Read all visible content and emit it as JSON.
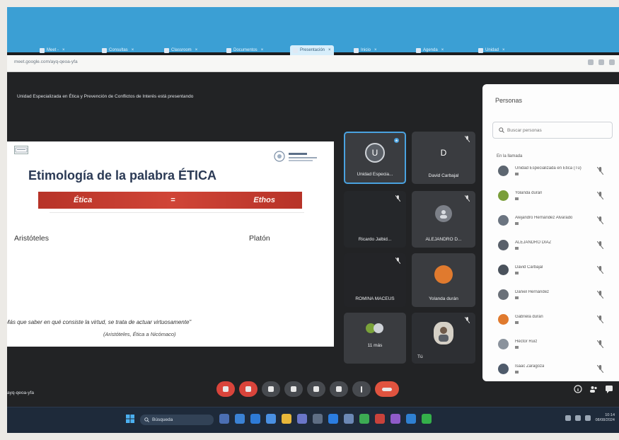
{
  "browser": {
    "tabs": [
      {
        "label": "Meet -",
        "active": false
      },
      {
        "label": "Consultas",
        "active": false
      },
      {
        "label": "Classroom",
        "active": false
      },
      {
        "label": "Documentos",
        "active": false
      },
      {
        "label": "Presentación",
        "active": true
      },
      {
        "label": "Inicio",
        "active": false
      },
      {
        "label": "Agenda",
        "active": false
      },
      {
        "label": "Unidad",
        "active": false
      }
    ],
    "url": "meet.google.com/ayq-qeoa-yfa"
  },
  "meet": {
    "presenting_text": "Unidad Especializada en Ética y Prevención de Conflictos de Interés está presentando",
    "meeting_code": "ayq-qeoa-yfa",
    "slide": {
      "title": "Etimología de la palabra ÉTICA",
      "banner_left": "Ética",
      "banner_mid": "=",
      "banner_right": "Ethos",
      "left_name": "Aristóteles",
      "right_name": "Platón",
      "quote": "\"Más que saber en qué consiste la virtud, se trata de actuar virtuosamente\"",
      "citation": "(Aristóteles, Ética a Nicómaco)"
    },
    "tiles": [
      {
        "name": "Unidad Especia...",
        "initial": "U",
        "avatar_color": "#5a5f66"
      },
      {
        "name": "David Carbajal",
        "initial": "D",
        "avatar_color": "#3a3c40"
      },
      {
        "name": "Ricardo Jalbid...",
        "initial": "",
        "avatar_color": ""
      },
      {
        "name": "ALEJANDRO D...",
        "initial": "",
        "avatar_color": "#7c8088"
      },
      {
        "name": "ROMINA MACEUS",
        "initial": "",
        "avatar_color": ""
      },
      {
        "name": "Yolanda durán",
        "initial": "",
        "avatar_color": "#e07a2e"
      },
      {
        "name": "11 más",
        "initial": "",
        "avatar_color": ""
      },
      {
        "name": "Tú",
        "initial": "",
        "avatar_color": ""
      }
    ]
  },
  "people": {
    "title": "Personas",
    "search_placeholder": "Buscar personas",
    "section_label": "En la llamada",
    "list": [
      {
        "name": "Unidad Especializada en Ética (Tú)",
        "color": "#5d6670"
      },
      {
        "name": "Yolanda durán",
        "color": "#7a9e3a"
      },
      {
        "name": "Alejandro Hernández Alvarado",
        "color": "#6b7480"
      },
      {
        "name": "ALEJANDRO DIAZ",
        "color": "#59606a"
      },
      {
        "name": "David Carbajal",
        "color": "#4a525c"
      },
      {
        "name": "Daniel Hernández",
        "color": "#6a7078"
      },
      {
        "name": "Gabriela durán",
        "color": "#e07a2e"
      },
      {
        "name": "Héctor Ruiz",
        "color": "#8a929c"
      },
      {
        "name": "Isaac Zaragoza",
        "color": "#4f5b6b"
      }
    ]
  },
  "taskbar": {
    "search_text": "Búsqueda",
    "time": "10:14",
    "date": "08/08/2024"
  },
  "colors": {
    "accent": "#3b9fd4",
    "slide_banner": "#c0392b",
    "end_call": "#e0533f"
  }
}
